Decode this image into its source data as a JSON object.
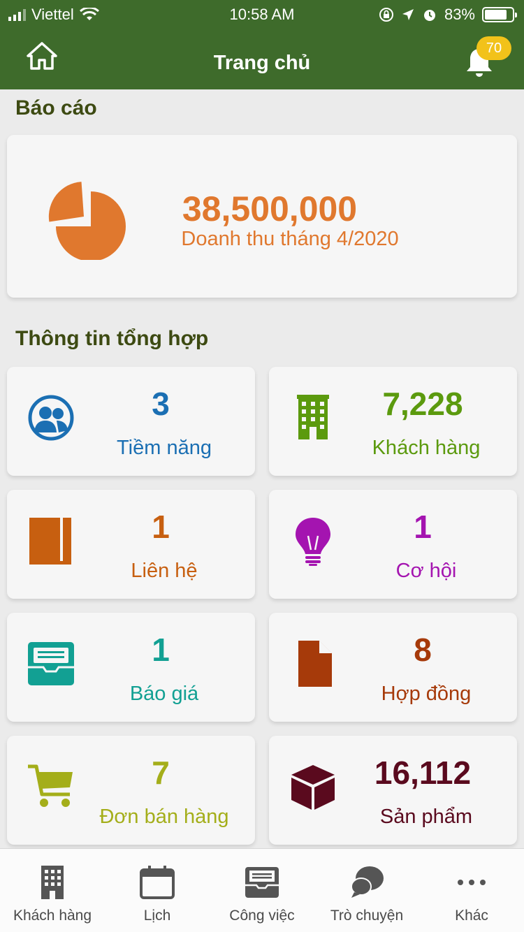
{
  "status": {
    "carrier": "Viettel",
    "time": "10:58 AM",
    "battery": "83%",
    "battery_level": 0.83
  },
  "header": {
    "title": "Trang chủ",
    "notification_count": "70",
    "accent": "#3e6b2b"
  },
  "report": {
    "section_title": "Báo cáo",
    "value": "38,500,000",
    "label": "Doanh thu tháng 4/2020",
    "color": "#e0782e",
    "icon": "pie-chart-icon"
  },
  "summary": {
    "section_title": "Thông tin tổng hợp",
    "tiles": [
      {
        "count": "3",
        "label": "Tiềm năng",
        "color": "#1b6fb3",
        "icon": "users-icon"
      },
      {
        "count": "7,228",
        "label": "Khách hàng",
        "color": "#5b9a0e",
        "icon": "building-icon"
      },
      {
        "count": "1",
        "label": "Liên hệ",
        "color": "#c75f10",
        "icon": "book-icon"
      },
      {
        "count": "1",
        "label": "Cơ hội",
        "color": "#a414b0",
        "icon": "lightbulb-icon"
      },
      {
        "count": "1",
        "label": "Báo giá",
        "color": "#12a093",
        "icon": "inbox-icon"
      },
      {
        "count": "8",
        "label": "Hợp đồng",
        "color": "#a63a0a",
        "icon": "document-icon"
      },
      {
        "count": "7",
        "label": "Đơn bán hàng",
        "color": "#a4ae1a",
        "icon": "cart-icon"
      },
      {
        "count": "16,112",
        "label": "Sản phẩm",
        "color": "#5a0a1e",
        "icon": "box-icon"
      }
    ]
  },
  "tabbar": {
    "items": [
      {
        "label": "Khách hàng",
        "icon": "building-icon"
      },
      {
        "label": "Lịch",
        "icon": "calendar-icon"
      },
      {
        "label": "Công việc",
        "icon": "inbox-icon"
      },
      {
        "label": "Trò chuyện",
        "icon": "chat-icon"
      },
      {
        "label": "Khác",
        "icon": "more-icon"
      }
    ]
  }
}
